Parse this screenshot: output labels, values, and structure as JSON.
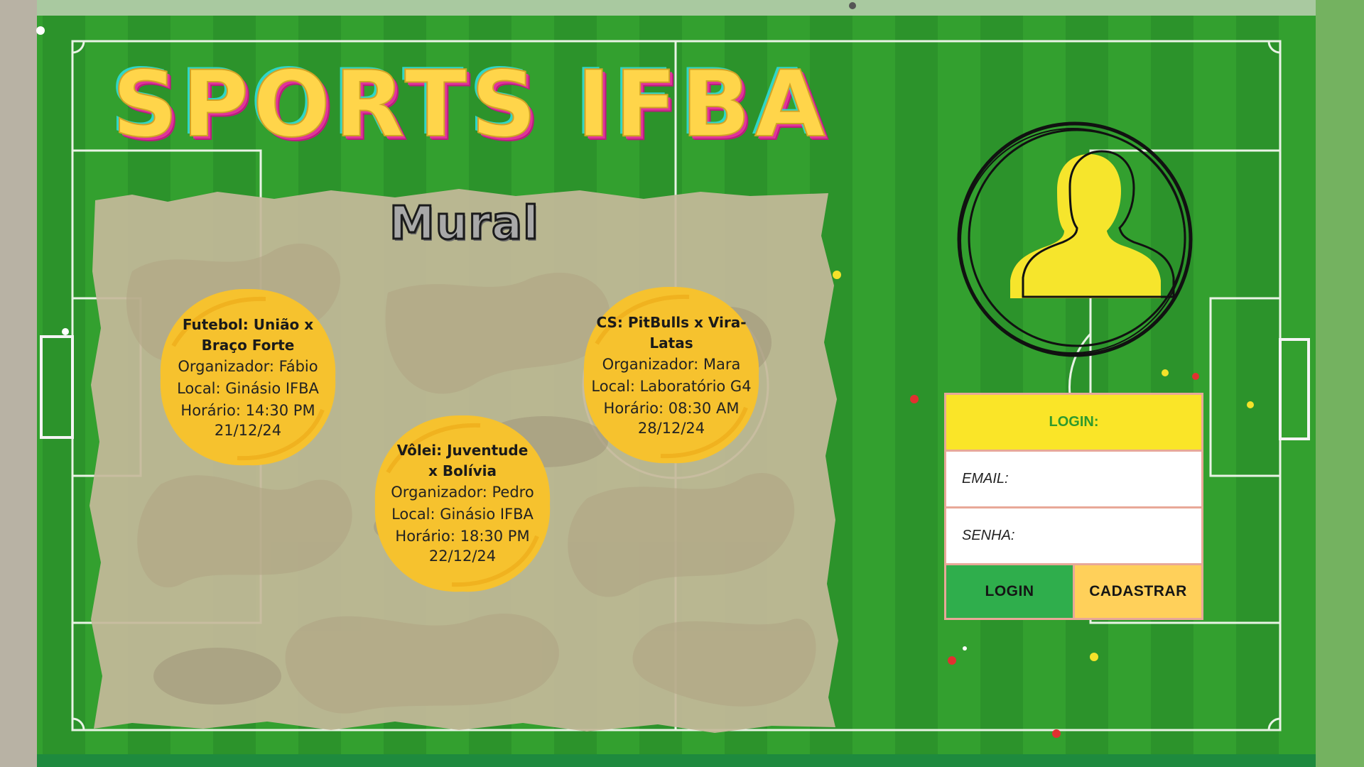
{
  "app": {
    "title": "SPORTS IFBA"
  },
  "mural": {
    "title": "Mural",
    "events": [
      {
        "name": "Futebol: União x Braço Forte",
        "organizer": "Organizador: Fábio",
        "location": "Local: Ginásio IFBA",
        "time": "Horário: 14:30 PM",
        "date": "21/12/24"
      },
      {
        "name": "CS: PitBulls x Vira-Latas",
        "organizer": "Organizador: Mara",
        "location": "Local: Laboratório G4",
        "time": "Horário: 08:30 AM",
        "date": "28/12/24"
      },
      {
        "name": "Vôlei: Juventude x Bolívia",
        "organizer": "Organizador: Pedro",
        "location": "Local: Ginásio IFBA",
        "time": "Horário: 18:30 PM",
        "date": "22/12/24"
      }
    ]
  },
  "login": {
    "header": "LOGIN:",
    "email_label": "EMAIL:",
    "password_label": "SENHA:",
    "email_value": "",
    "password_value": "",
    "login_button": "LOGIN",
    "register_button": "CADASTRAR"
  },
  "avatar": {
    "icon": "user-avatar-icon"
  },
  "colors": {
    "pitch": "#2f9a2c",
    "title": "#ffd54a",
    "event_blob": "#f6c22e",
    "login_header": "#fae528",
    "login_button": "#2fae4c",
    "register_button": "#ffd05a"
  }
}
